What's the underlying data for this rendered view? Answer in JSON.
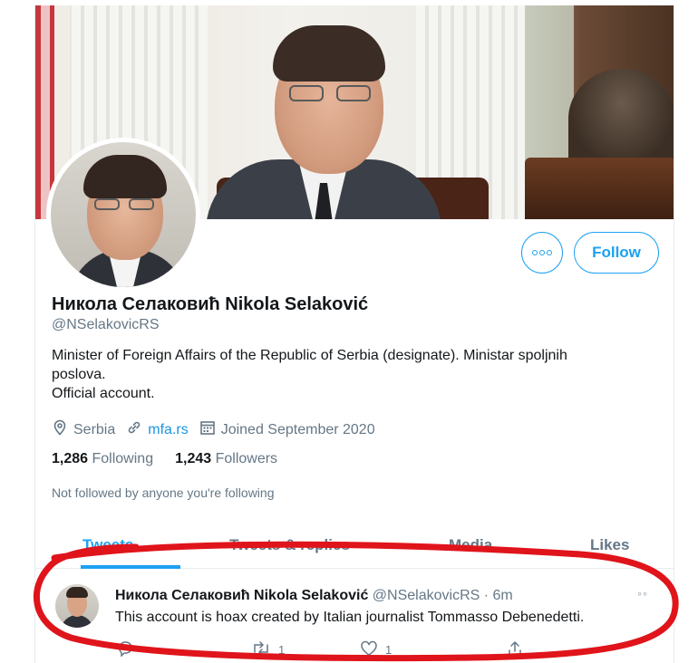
{
  "profile": {
    "name": "Никола Селаковић Nikola Selaković",
    "handle": "@NSelakovicRS",
    "bio_lines": [
      "Minister of Foreign Affairs of the Republic of Serbia (designate). Ministar spoljnih",
      "poslova.",
      "Official account."
    ],
    "location": "Serbia",
    "website": "mfa.rs",
    "joined": "Joined September 2020",
    "following_count": "1,286",
    "following_label": "Following",
    "followers_count": "1,243",
    "followers_label": "Followers",
    "not_followed": "Not followed by anyone you're following"
  },
  "buttons": {
    "follow_label": "Follow",
    "more_icon": "more-options-icon"
  },
  "tabs": [
    {
      "label": "Tweets",
      "active": true
    },
    {
      "label": "Tweets & replies",
      "active": false
    },
    {
      "label": "Media",
      "active": false
    },
    {
      "label": "Likes",
      "active": false
    }
  ],
  "tweet": {
    "author_name": "Никола Селаковић Nikola Selaković",
    "author_handle_time": "@NSelakovicRS · 6m",
    "text": "This account is hoax created by Italian journalist Tommasso Debenedetti.",
    "retweets": "1",
    "likes": "1"
  },
  "colors": {
    "accent": "#1da1f2",
    "secondary_text": "#657786",
    "annotation": "#e0141b"
  }
}
